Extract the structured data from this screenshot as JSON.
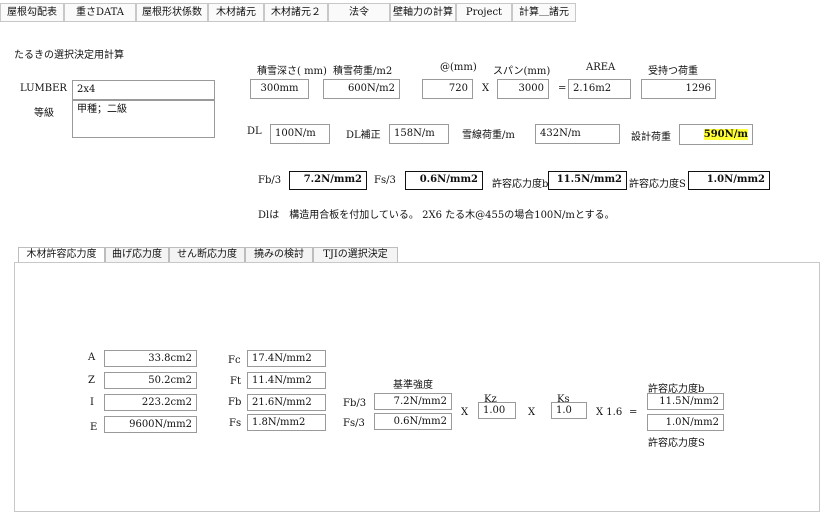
{
  "top_tabs": [
    "屋根勾配表",
    "重さDATA",
    "屋根形状係数",
    "木材諸元",
    "木材諸元２",
    "法令",
    "壁軸力の計算",
    "Project",
    "計算＿諸元"
  ],
  "section_title": "たるきの選択決定用計算",
  "header_labels": {
    "snow_depth": "積雪深さ( mm)",
    "snow_load": "積雪荷重/m2",
    "pitch": "@(mm)",
    "span": "スパン(mm)",
    "area": "AREA",
    "share_load": "受持つ荷重"
  },
  "lumber": {
    "label": "LUMBER",
    "value": "2x4"
  },
  "grade": {
    "label": "等級",
    "value": "甲種；二級"
  },
  "inputs": {
    "snow_depth": "300mm",
    "snow_load": "600N/m2",
    "pitch": "720",
    "x": "X",
    "span": "3000",
    "eq": "=",
    "area": "2.16m2",
    "share_load": "1296"
  },
  "dl_row": {
    "dl_label": "DL",
    "dl_value": "100N/m",
    "dl_adj_label": "DL補正",
    "dl_adj_value": "158N/m",
    "snow_line_label": "雪線荷重/m",
    "snow_line_value": "432N/m",
    "design_label": "設計荷重",
    "design_value": "590N/m"
  },
  "stress_row": {
    "fb3_label": "Fb/3",
    "fb3_value": "7.2N/mm2",
    "fs3_label": "Fs/3",
    "fs3_value": "0.6N/mm2",
    "allow_b_label": "許容応力度b",
    "allow_b_value": "11.5N/mm2",
    "allow_s_label": "許容応力度S",
    "allow_s_value": "1.0N/mm2"
  },
  "note": "Dlは　構造用合板を付加している。 2X6 たる木@455の場合100N/mとする。",
  "sub_tabs": [
    "木材許容応力度",
    "曲げ応力度",
    "せん断応力度",
    "撓みの検討",
    "TJIの選択決定"
  ],
  "props": [
    {
      "label": "A",
      "value": "33.8cm2"
    },
    {
      "label": "Z",
      "value": "50.2cm2"
    },
    {
      "label": "I",
      "value": "223.2cm2"
    },
    {
      "label": "E",
      "value": "9600N/mm2"
    }
  ],
  "strengths": [
    {
      "label": "Fc",
      "value": "17.4N/mm2"
    },
    {
      "label": "Ft",
      "value": "11.4N/mm2"
    },
    {
      "label": "Fb",
      "value": "21.6N/mm2"
    },
    {
      "label": "Fs",
      "value": "1.8N/mm2"
    }
  ],
  "base_strength": {
    "title": "基準強度",
    "fb3_label": "Fb/3",
    "fb3_value": "7.2N/mm2",
    "fs3_label": "Fs/3",
    "fs3_value": "0.6N/mm2"
  },
  "factors": {
    "x1": "X",
    "kz_label": "Kz",
    "kz_value": "1.00",
    "x2": "X",
    "ks_label": "Ks",
    "ks_value": "1.0",
    "mult": "X 1.6",
    "eq": "="
  },
  "result": {
    "allow_b_label": "許容応力度b",
    "allow_b_value": "11.5N/mm2",
    "allow_s_value": "1.0N/mm2",
    "allow_s_label": "許容応力度S"
  },
  "colors": {
    "highlight": "#ffff33",
    "border": "#9a9a9a"
  }
}
